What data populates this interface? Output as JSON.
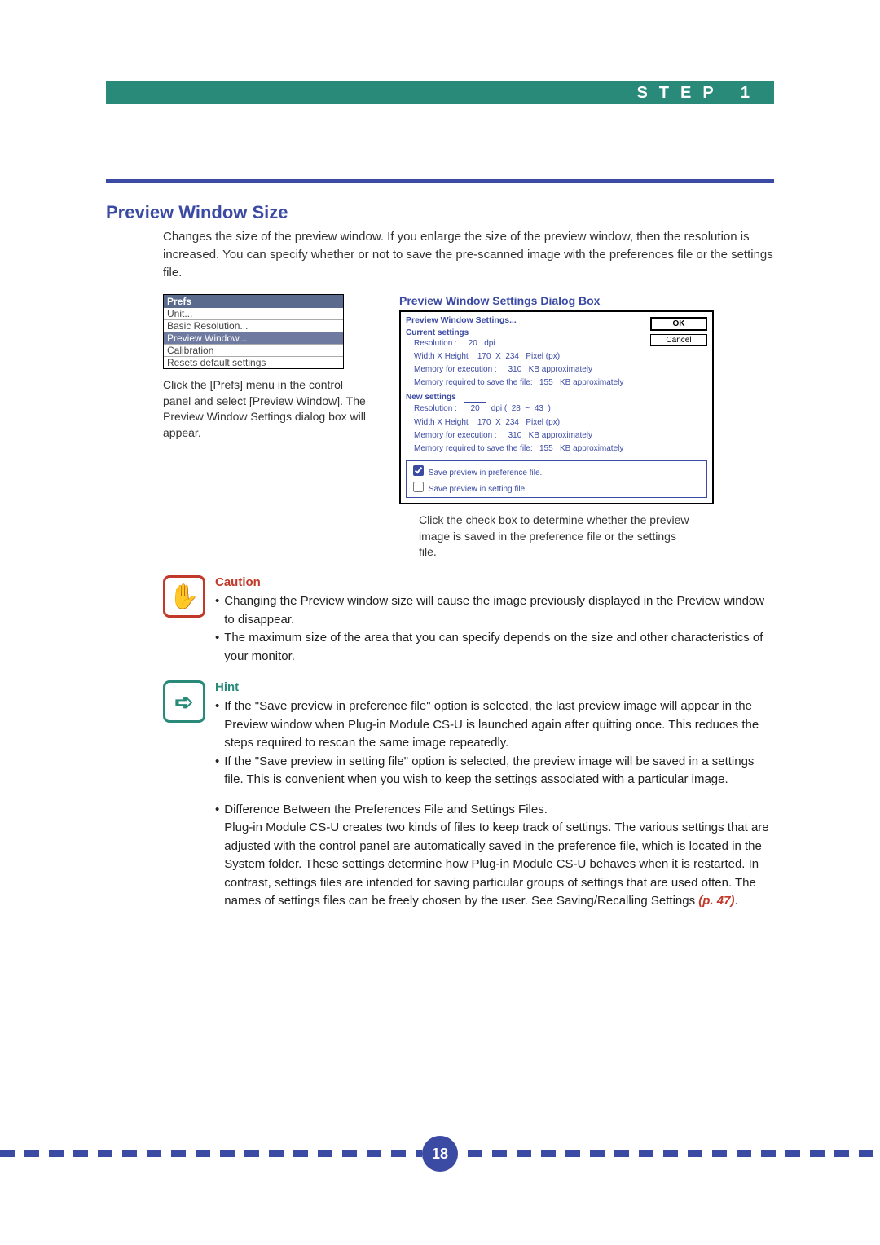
{
  "header": {
    "step_label": "STEP 1"
  },
  "title": "Preview Window Size",
  "intro": "Changes the size of the preview window. If you enlarge the size of the preview window, then the resolution is increased. You can specify whether or not to save the pre-scanned image with the preferences file or the settings file.",
  "menu": {
    "title": "Prefs",
    "items": [
      {
        "label": "Unit...",
        "selected": false
      },
      {
        "label": "Basic Resolution...",
        "selected": false
      },
      {
        "label": "Preview Window...",
        "selected": true
      },
      {
        "label": "Calibration",
        "selected": false
      },
      {
        "label": "Resets default settings",
        "selected": false
      }
    ]
  },
  "menu_caption": "Click the [Prefs] menu in the control panel and select [Preview Window]. The Preview Window Settings dialog box will appear.",
  "dialog_label": "Preview Window Settings Dialog Box",
  "dialog": {
    "header": "Preview Window Settings...",
    "buttons": {
      "ok": "OK",
      "cancel": "Cancel"
    },
    "current": {
      "title": "Current settings",
      "resolution_label": "Resolution :",
      "resolution_value": "20",
      "resolution_unit": "dpi",
      "wh_label": "Width X Height",
      "wh_w": "170",
      "wh_x": "X",
      "wh_h": "234",
      "wh_unit": "Pixel (px)",
      "mem_exec_label": "Memory for execution :",
      "mem_exec_val": "310",
      "mem_exec_unit": "KB approximately",
      "mem_save_label": "Memory required to save the file:",
      "mem_save_val": "155",
      "mem_save_unit": "KB approximately"
    },
    "new": {
      "title": "New settings",
      "resolution_label": "Resolution :",
      "resolution_value": "20",
      "resolution_unit_prefix": "dpi (",
      "res_a": "28",
      "res_tilde": "~",
      "res_b": "43",
      "resolution_unit_suffix": ")",
      "wh_label": "Width X Height",
      "wh_w": "170",
      "wh_x": "X",
      "wh_h": "234",
      "wh_unit": "Pixel (px)",
      "mem_exec_label": "Memory for execution :",
      "mem_exec_val": "310",
      "mem_exec_unit": "KB approximately",
      "mem_save_label": "Memory required to save the file:",
      "mem_save_val": "155",
      "mem_save_unit": "KB approximately"
    },
    "checks": {
      "pref": "Save preview in preference file.",
      "setting": "Save preview in setting file."
    }
  },
  "dialog_caption": "Click the check box to determine whether the preview image is saved in the preference file or the settings file.",
  "caution": {
    "title": "Caution",
    "items": [
      "Changing the Preview window size will cause the image previously displayed in the Preview window to disappear.",
      "The maximum size of the area that you can specify depends on the size and other characteristics of your monitor."
    ]
  },
  "hint": {
    "title": "Hint",
    "items": [
      "If the \"Save preview in preference file\" option is selected, the last preview image will appear in the Preview window when Plug-in Module CS-U is launched again after quitting once. This reduces the steps required to rescan the same image repeatedly.",
      "If the \"Save preview in setting file\" option is selected, the preview image will be saved in a settings file. This is convenient when you wish to keep the settings associated with a particular image."
    ],
    "diff_title": "Difference Between the Preferences File and Settings Files.",
    "diff_body": "Plug-in Module CS-U creates two kinds of files to keep track of settings. The various settings that are adjusted with the control panel are automatically saved in the preference file, which is located in the System folder. These settings determine how Plug-in Module CS-U behaves when it is restarted. In contrast, settings files are intended for saving particular groups of settings that are used often. The names of settings files can be freely chosen by the user. See Saving/Recalling Settings ",
    "diff_ref": "(p. 47)",
    "diff_end": "."
  },
  "page_number": "18"
}
